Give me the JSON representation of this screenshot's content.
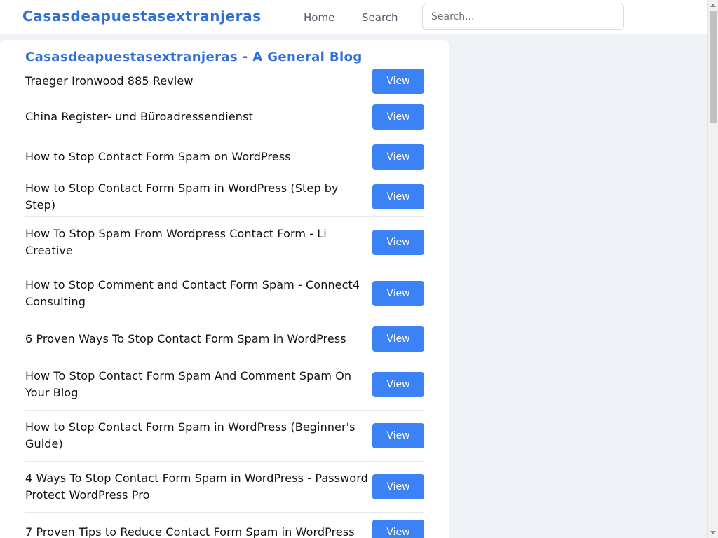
{
  "header": {
    "brand": "Casasdeapuestasextranjeras",
    "nav": [
      {
        "label": "Home"
      },
      {
        "label": "Search"
      }
    ],
    "search": {
      "placeholder": "Search...",
      "value": ""
    }
  },
  "main": {
    "title": "Casasdeapuestasextranjeras - A General Blog",
    "view_label": "View",
    "posts": [
      {
        "title": "Traeger Ironwood 885 Review"
      },
      {
        "title": "China Register- und Büroadressendienst"
      },
      {
        "title": "How to Stop Contact Form Spam on WordPress"
      },
      {
        "title": "How to Stop Contact Form Spam in WordPress (Step by Step)"
      },
      {
        "title": "How To Stop Spam From Wordpress Contact Form - Li Creative"
      },
      {
        "title": "How to Stop Comment and Contact Form Spam - Connect4 Consulting"
      },
      {
        "title": "6 Proven Ways To Stop Contact Form Spam in WordPress"
      },
      {
        "title": "How To Stop Contact Form Spam And Comment Spam On Your Blog"
      },
      {
        "title": "How to Stop Contact Form Spam in WordPress (Beginner's Guide)"
      },
      {
        "title": "4 Ways To Stop Contact Form Spam in WordPress - Password Protect WordPress Pro"
      },
      {
        "title": "7 Proven Tips to Reduce Contact Form Spam in WordPress"
      }
    ]
  },
  "colors": {
    "accent": "#2f6fd6",
    "button": "#3b82f6",
    "page_background": "#eef2f7"
  }
}
